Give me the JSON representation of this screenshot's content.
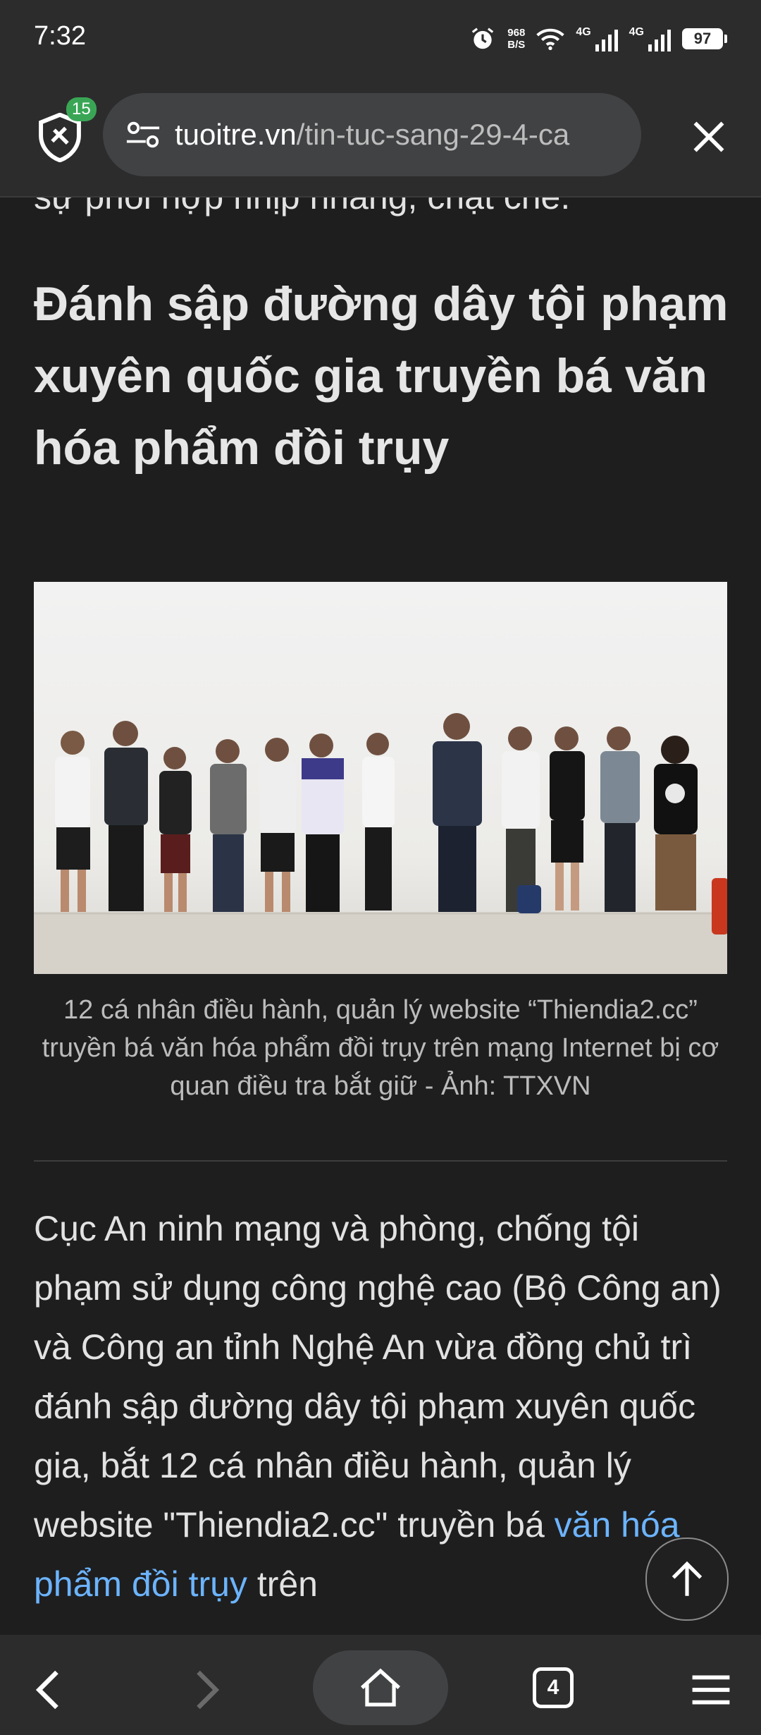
{
  "status_bar": {
    "time": "7:32",
    "net_speed_value": "968",
    "net_speed_unit": "B/S",
    "signal1_label": "4G",
    "signal2_label": "4G",
    "battery": "97"
  },
  "browser": {
    "shield_badge": "15",
    "url_host": "tuoitre.vn",
    "url_path": "/tin-tuc-sang-29-4-ca"
  },
  "article": {
    "previous_text": "sự phối hợp nhịp nhàng, chặt chẽ.",
    "heading": "Đánh sập đường dây tội phạm xuyên quốc gia truyền bá văn hóa phẩm đồi trụy",
    "caption": "12 cá nhân điều hành, quản lý website “Thiendia2.cc” truyền bá văn hóa phẩm đồi trụy trên mạng Internet bị cơ quan điều tra bắt giữ - Ảnh: TTXVN",
    "body_before_link": "Cục An ninh mạng và phòng, chống tội phạm sử dụng công nghệ cao (Bộ Công an) và Công an tỉnh Nghệ An vừa đồng chủ trì đánh sập đường dây tội phạm xuyên quốc gia, bắt 12 cá nhân điều hành, quản lý website \"Thiendia2.cc\" truyền bá ",
    "body_link": "văn hóa phẩm đồi trụy",
    "body_after_link": " trên"
  },
  "bottom_nav": {
    "tab_count": "4"
  },
  "colors": {
    "background": "#1e1e1f",
    "toolbar": "#2c2c2d",
    "link": "#6cb4ff",
    "badge": "#3aa655"
  },
  "icons": [
    "alarm-icon",
    "wifi-icon",
    "signal-icon",
    "battery-icon",
    "shield-icon",
    "tune-icon",
    "close-icon",
    "arrow-up-icon",
    "back-icon",
    "forward-icon",
    "home-icon",
    "tabs-icon",
    "menu-icon"
  ]
}
